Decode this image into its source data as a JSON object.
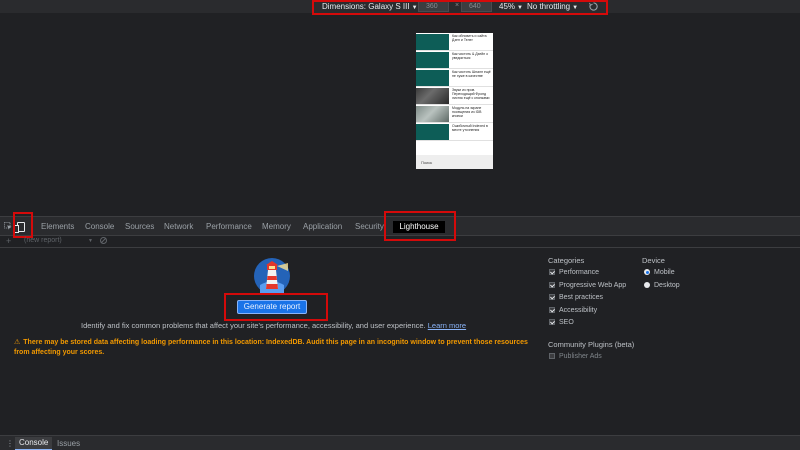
{
  "device_toolbar": {
    "dimensions_label": "Dimensions: Galaxy S III",
    "width_value": "360",
    "height_value": "640",
    "zoom": "45%",
    "throttling": "No throttling"
  },
  "emulated_page": {
    "articles": [
      {
        "title": "Как обновить и сайта Дзен и Телег"
      },
      {
        "title": "Как чистить & Дзейн о уведоиться"
      },
      {
        "title": "Как чистить Шпалн ещё не хуже в качестве"
      },
      {
        "title": "Звуки из пров. Переходящий Фронд листик ещё с кнопками"
      },
      {
        "title": "Модуль на экране посещения из IDB кнопки"
      },
      {
        "title": "Ошибочный Indexed в месте уточнения"
      }
    ],
    "footer_text": "Поиск"
  },
  "devtools": {
    "tabs": [
      "Elements",
      "Console",
      "Sources",
      "Network",
      "Performance",
      "Memory",
      "Application",
      "Security"
    ],
    "active_tab": "Lighthouse",
    "report_select": "(new report)",
    "generate_button": "Generate report",
    "description": "Identify and fix common problems that affect your site's performance, accessibility, and user experience.",
    "learn_more": "Learn more",
    "warning": "There may be stored data affecting loading performance in this location: IndexedDB. Audit this page in an incognito window to prevent those resources from affecting your scores.",
    "categories": {
      "heading": "Categories",
      "items": [
        {
          "label": "Performance",
          "checked": true
        },
        {
          "label": "Progressive Web App",
          "checked": true
        },
        {
          "label": "Best practices",
          "checked": true
        },
        {
          "label": "Accessibility",
          "checked": true
        },
        {
          "label": "SEO",
          "checked": true
        }
      ]
    },
    "device": {
      "heading": "Device",
      "options": [
        {
          "label": "Mobile",
          "selected": true
        },
        {
          "label": "Desktop",
          "selected": false
        }
      ]
    },
    "plugins": {
      "heading": "Community Plugins (beta)",
      "items": [
        {
          "label": "Publisher Ads",
          "checked": false
        }
      ]
    }
  },
  "drawer": {
    "tabs": [
      "Console",
      "Issues"
    ]
  },
  "colors": {
    "highlight": "#d40a0a",
    "accent": "#1a73e8",
    "warning": "#f29900"
  }
}
